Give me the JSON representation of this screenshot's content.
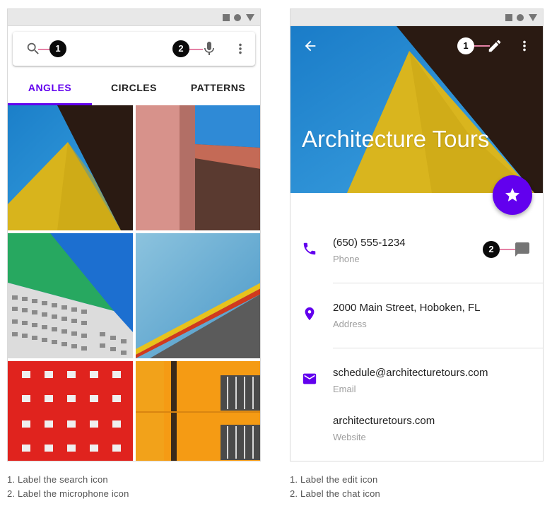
{
  "left_screen": {
    "search_bar": {
      "icons": [
        "search-icon",
        "mic-icon",
        "more-vert-icon"
      ]
    },
    "tabs": [
      {
        "label": "ANGLES",
        "active": true
      },
      {
        "label": "CIRCLES",
        "active": false
      },
      {
        "label": "PATTERNS",
        "active": false
      }
    ],
    "annotations": [
      "1",
      "2"
    ],
    "captions": [
      "1. Label the search icon",
      "2. Label the microphone icon"
    ]
  },
  "right_screen": {
    "app_bar": {
      "icons": [
        "arrow-back-icon",
        "edit-icon",
        "more-vert-icon"
      ]
    },
    "title": "Architecture Tours",
    "fab_icon": "star-icon",
    "contacts": [
      {
        "value": "(650) 555-1234",
        "label": "Phone",
        "icon": "phone-icon"
      },
      {
        "value": "2000 Main Street, Hoboken, FL",
        "label": "Address",
        "icon": "location-icon"
      },
      {
        "value": "schedule@architecturetours.com",
        "label": "Email",
        "icon": "email-icon"
      },
      {
        "value": "architecturetours.com",
        "label": "Website",
        "icon": ""
      }
    ],
    "annotations": [
      "1",
      "2"
    ],
    "captions": [
      "1. Label the edit icon",
      "2. Label the chat icon"
    ]
  },
  "colors": {
    "primary": "#6200ee",
    "annotation_line": "#e582a6",
    "status_bar": "#e8e8e8",
    "secondary_text": "#9e9e9e"
  }
}
